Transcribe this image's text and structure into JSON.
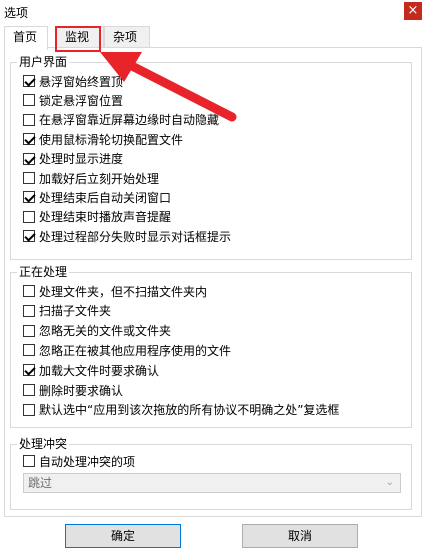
{
  "window": {
    "title": "选项",
    "close_label": "×"
  },
  "tabs": [
    {
      "label": "首页",
      "active": true
    },
    {
      "label": "监视",
      "active": false
    },
    {
      "label": "杂项",
      "active": false
    }
  ],
  "groups": {
    "ui": {
      "title": "用户界面",
      "items": [
        {
          "label": "悬浮窗始终置顶",
          "checked": true
        },
        {
          "label": "锁定悬浮窗位置",
          "checked": false
        },
        {
          "label": "在悬浮窗靠近屏幕边缘时自动隐藏",
          "checked": false
        },
        {
          "label": "使用鼠标滑轮切换配置文件",
          "checked": true
        },
        {
          "label": "处理时显示进度",
          "checked": true
        },
        {
          "label": "加载好后立刻开始处理",
          "checked": false
        },
        {
          "label": "处理结束后自动关闭窗口",
          "checked": true
        },
        {
          "label": "处理结束时播放声音提醒",
          "checked": false
        },
        {
          "label": "处理过程部分失败时显示对话框提示",
          "checked": true
        }
      ]
    },
    "processing": {
      "title": "正在处理",
      "items": [
        {
          "label": "处理文件夹，但不扫描文件夹内",
          "checked": false
        },
        {
          "label": "扫描子文件夹",
          "checked": false
        },
        {
          "label": "忽略无关的文件或文件夹",
          "checked": false
        },
        {
          "label": "忽略正在被其他应用程序使用的文件",
          "checked": false
        },
        {
          "label": "加载大文件时要求确认",
          "checked": true
        },
        {
          "label": "删除时要求确认",
          "checked": false
        },
        {
          "label": "默认选中“应用到该次拖放的所有协议不明确之处”复选框",
          "checked": false
        }
      ]
    },
    "conflict": {
      "title": "处理冲突",
      "items": [
        {
          "label": "自动处理冲突的项",
          "checked": false
        }
      ],
      "select_value": "跳过"
    }
  },
  "footer": {
    "ok_label": "确定",
    "cancel_label": "取消"
  },
  "colors": {
    "highlight": "#e8232a",
    "accent": "#0078d7"
  }
}
